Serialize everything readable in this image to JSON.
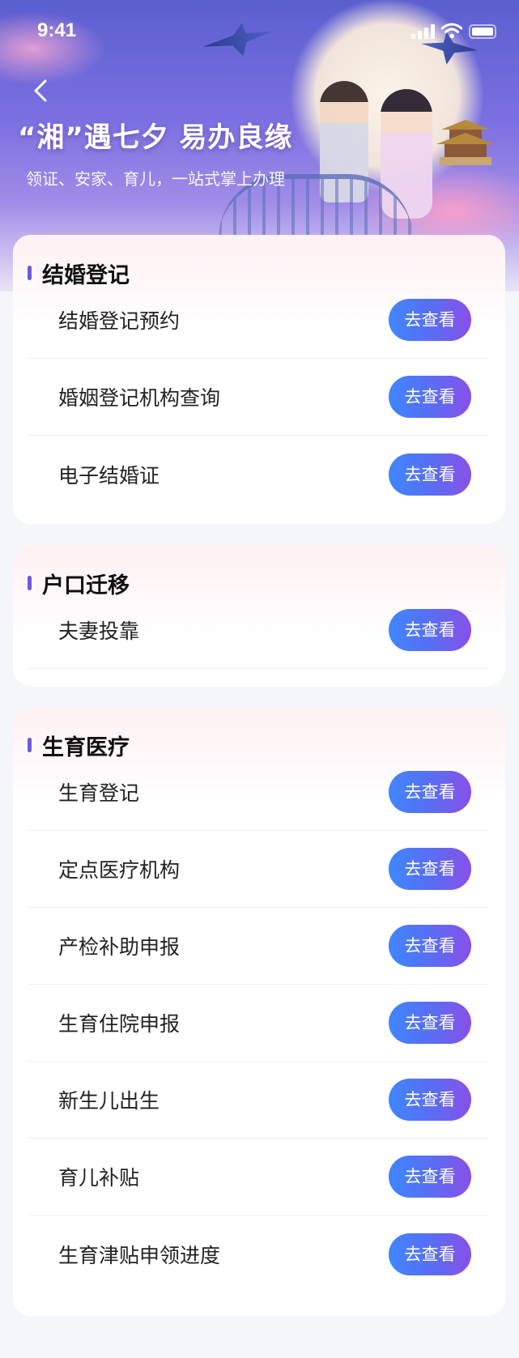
{
  "status_bar": {
    "time": "9:41"
  },
  "hero": {
    "title": "“湘”遇七夕  易办良缘",
    "subtitle": "领证、安家、育儿，一站式掌上办理"
  },
  "theme": {
    "accent": "#6b5bdc",
    "button_from": "#3f86ff",
    "button_to": "#8a4fe8"
  },
  "sections": [
    {
      "title": "结婚登记",
      "items": [
        {
          "label": "结婚登记预约",
          "action": "去查看"
        },
        {
          "label": "婚姻登记机构查询",
          "action": "去查看"
        },
        {
          "label": "电子结婚证",
          "action": "去查看"
        }
      ]
    },
    {
      "title": "户口迁移",
      "items": [
        {
          "label": "夫妻投靠",
          "action": "去查看"
        }
      ]
    },
    {
      "title": "生育医疗",
      "items": [
        {
          "label": "生育登记",
          "action": "去查看"
        },
        {
          "label": "定点医疗机构",
          "action": "去查看"
        },
        {
          "label": "产检补助申报",
          "action": "去查看"
        },
        {
          "label": "生育住院申报",
          "action": "去查看"
        },
        {
          "label": "新生儿出生",
          "action": "去查看"
        },
        {
          "label": "育儿补贴",
          "action": "去查看"
        },
        {
          "label": "生育津贴申领进度",
          "action": "去查看"
        }
      ]
    }
  ]
}
